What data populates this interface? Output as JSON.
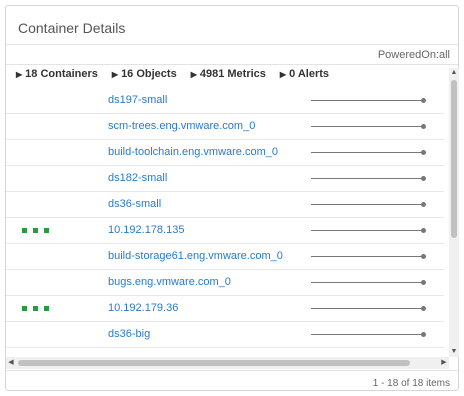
{
  "panel": {
    "title": "Container Details",
    "filter": "PoweredOn:all"
  },
  "summary": [
    {
      "label": "18 Containers"
    },
    {
      "label": "16 Objects"
    },
    {
      "label": "4981 Metrics"
    },
    {
      "label": "0 Alerts"
    }
  ],
  "rows": [
    {
      "name": "ds197-small",
      "status_dots": false
    },
    {
      "name": "scm-trees.eng.vmware.com_0",
      "status_dots": false
    },
    {
      "name": "build-toolchain.eng.vmware.com_0",
      "status_dots": false
    },
    {
      "name": "ds182-small",
      "status_dots": false
    },
    {
      "name": "ds36-small",
      "status_dots": false
    },
    {
      "name": "10.192.178.135",
      "status_dots": true
    },
    {
      "name": "build-storage61.eng.vmware.com_0",
      "status_dots": false
    },
    {
      "name": "bugs.eng.vmware.com_0",
      "status_dots": false
    },
    {
      "name": "10.192.179.36",
      "status_dots": true
    },
    {
      "name": "ds36-big",
      "status_dots": false
    }
  ],
  "colors": {
    "link": "#2a7bc6",
    "status_green": "#2b9a3a"
  },
  "footer": {
    "pagination": "1 - 18 of 18 items"
  }
}
